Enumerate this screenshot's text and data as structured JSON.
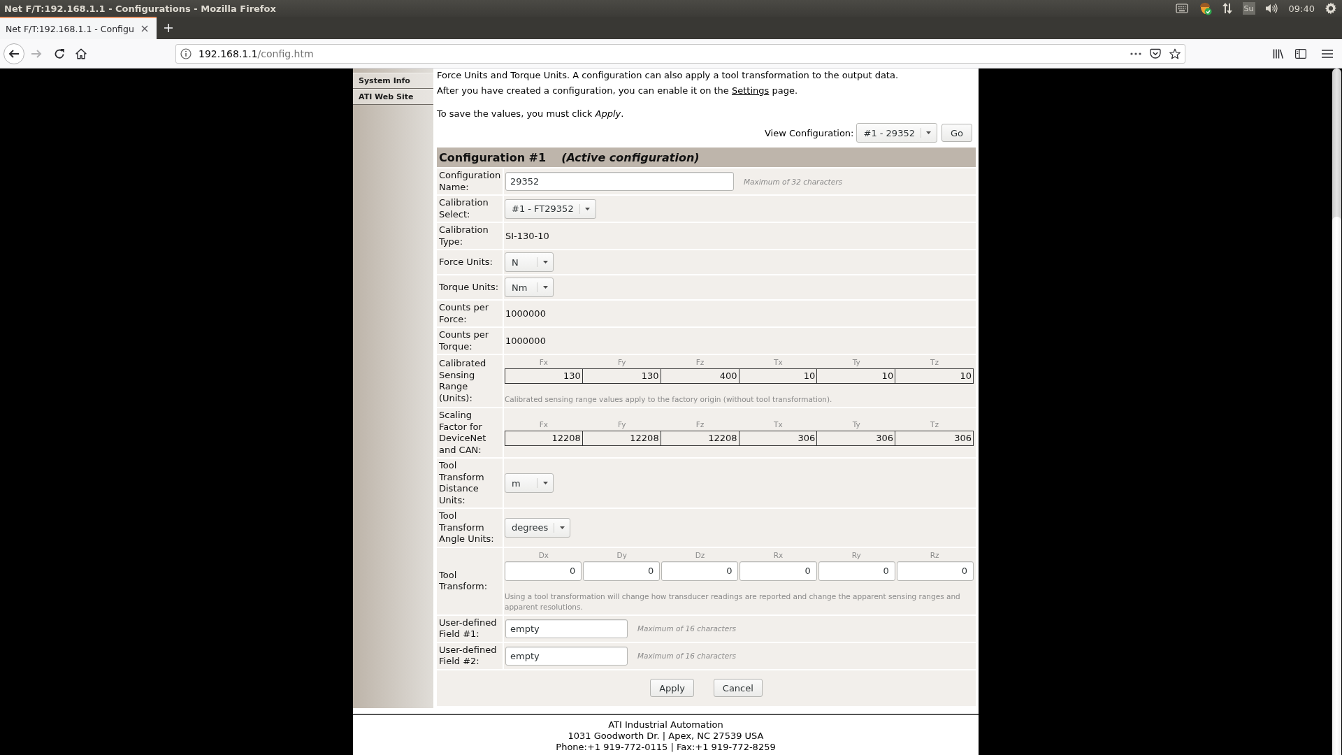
{
  "window": {
    "title": "Net F/T:192.168.1.1 - Configurations - Mozilla Firefox"
  },
  "system_tray": {
    "input_method": "Su",
    "clock": "09:40"
  },
  "tabs": [
    {
      "label": "Net F/T:192.168.1.1 - Configu",
      "selected": true
    }
  ],
  "forward_button": {
    "disabled": true
  },
  "address_bar": {
    "host": "192.168.1.1",
    "path": "/config.htm"
  },
  "sidebar": {
    "items": [
      {
        "label": "System Info"
      },
      {
        "label": "ATI Web Site"
      }
    ]
  },
  "intro": [
    {
      "text": "Force Units and Torque Units. A configuration can also apply a tool transformation to the output data."
    },
    {
      "text": "After you have created a configuration, you can enable it on the ",
      "link": "Settings",
      "after": " page."
    },
    {
      "text": "To save the values, you must click *Apply*."
    }
  ],
  "view_configuration": {
    "label": "View Configuration:",
    "value": "#1 - 29352",
    "button": "Go"
  },
  "configuration": {
    "title": "Configuration #1",
    "status": "(Active configuration)",
    "rows": [
      {
        "kind": "longfield",
        "label": "Configuration Name:",
        "value": "29352",
        "hint": "Maximum of 32 characters"
      },
      {
        "kind": "select",
        "label": "Calibration Select:",
        "value": "#1 - FT29352"
      },
      {
        "kind": "text",
        "label": "Calibration Type:",
        "value": "SI-130-10"
      },
      {
        "kind": "select",
        "label": "Force Units:",
        "value": "N"
      },
      {
        "kind": "select",
        "label": "Torque Units:",
        "value": "Nm"
      },
      {
        "kind": "text",
        "label": "Counts per Force:",
        "value": "1000000"
      },
      {
        "kind": "text",
        "label": "Counts per Torque:",
        "value": "1000000"
      },
      {
        "kind": "value_grid",
        "label": "Calibrated Sensing Range (Units):",
        "columns": [
          "Fx",
          "Fy",
          "Fz",
          "Tx",
          "Ty",
          "Tz"
        ],
        "values": [
          "130",
          "130",
          "400",
          "10",
          "10",
          "10"
        ],
        "note": "Calibrated sensing range values apply to the factory origin (without tool transformation)."
      },
      {
        "kind": "value_grid",
        "label": "Scaling Factor for DeviceNet and CAN:",
        "columns": [
          "Fx",
          "Fy",
          "Fz",
          "Tx",
          "Ty",
          "Tz"
        ],
        "values": [
          "12208",
          "12208",
          "12208",
          "306",
          "306",
          "306"
        ]
      },
      {
        "kind": "select",
        "label": "Tool Transform Distance Units:",
        "value": "m"
      },
      {
        "kind": "select",
        "label": "Tool Transform Angle Units:",
        "value": "degrees"
      },
      {
        "kind": "input_grid",
        "label": "Tool Transform:",
        "columns": [
          "Dx",
          "Dy",
          "Dz",
          "Rx",
          "Ry",
          "Rz"
        ],
        "values": [
          "0",
          "0",
          "0",
          "0",
          "0",
          "0"
        ],
        "note": "Using a tool transformation will change how transducer readings are reported and change the apparent sensing ranges and apparent resolutions."
      },
      {
        "kind": "shortfield",
        "label": "User-defined Field #1:",
        "value": "empty",
        "hint": "Maximum of 16 characters"
      },
      {
        "kind": "shortfield",
        "label": "User-defined Field #2:",
        "value": "empty",
        "hint": "Maximum of 16 characters"
      }
    ],
    "buttons": [
      "Apply",
      "Cancel"
    ]
  },
  "footer": {
    "lines": [
      "ATI Industrial Automation",
      "1031 Goodworth Dr. | Apex, NC 27539 USA",
      "Phone:+1 919-772-0115 | Fax:+1 919-772-8259"
    ]
  }
}
